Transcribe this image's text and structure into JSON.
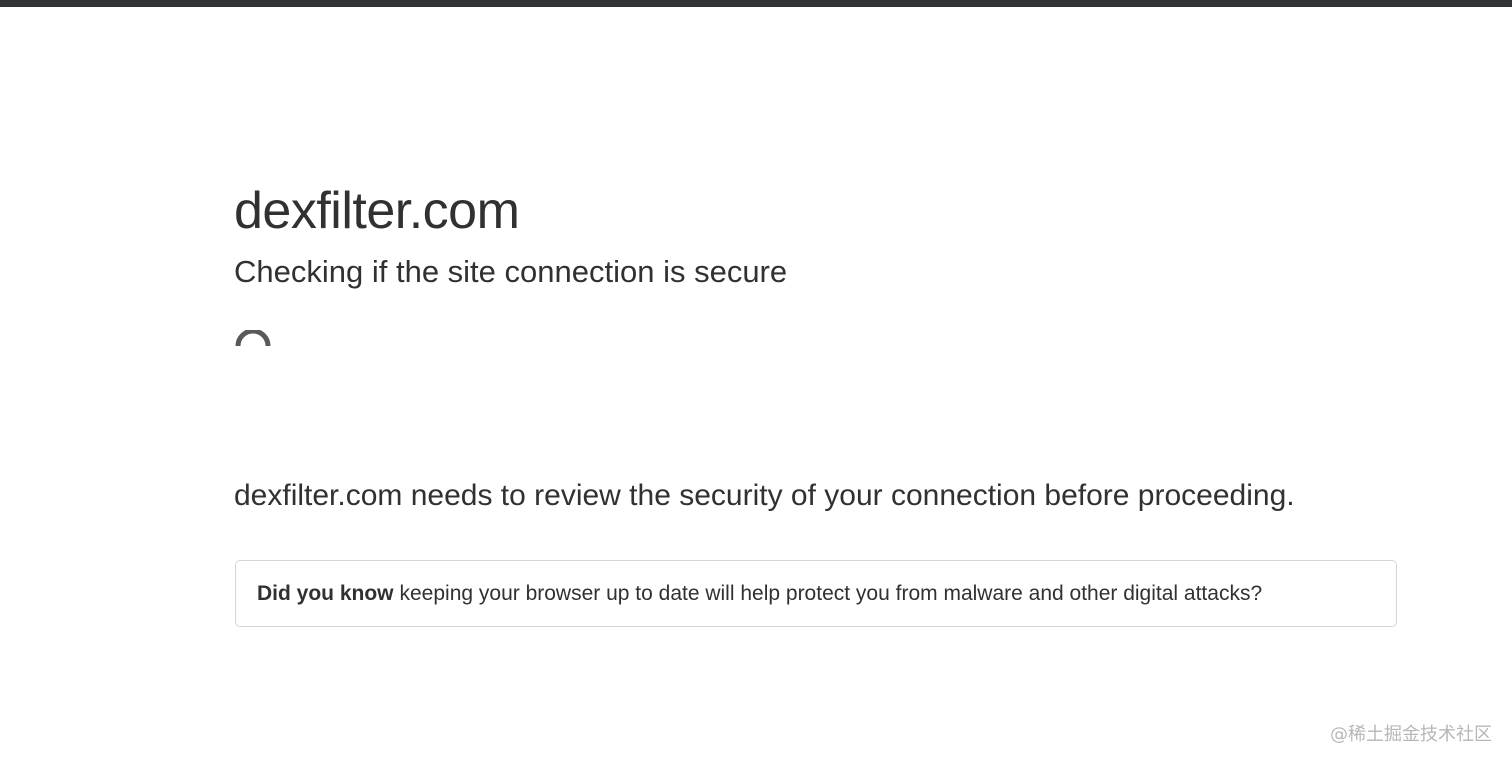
{
  "window": {
    "topbar_color": "#333436"
  },
  "header": {
    "site_name": "dexfilter.com",
    "status_text": "Checking if the site connection is secure"
  },
  "spinner": {
    "icon": "loading-spinner-icon"
  },
  "main": {
    "review_text": "dexfilter.com needs to review the security of your connection before proceeding."
  },
  "info_box": {
    "lead": "Did you know",
    "text": "keeping your browser up to date will help protect you from malware and other digital attacks?"
  },
  "watermark": {
    "text": "@稀土掘金技术社区"
  },
  "colors": {
    "text": "#313131",
    "border": "#d5d5d5",
    "spinner": "#595959"
  }
}
